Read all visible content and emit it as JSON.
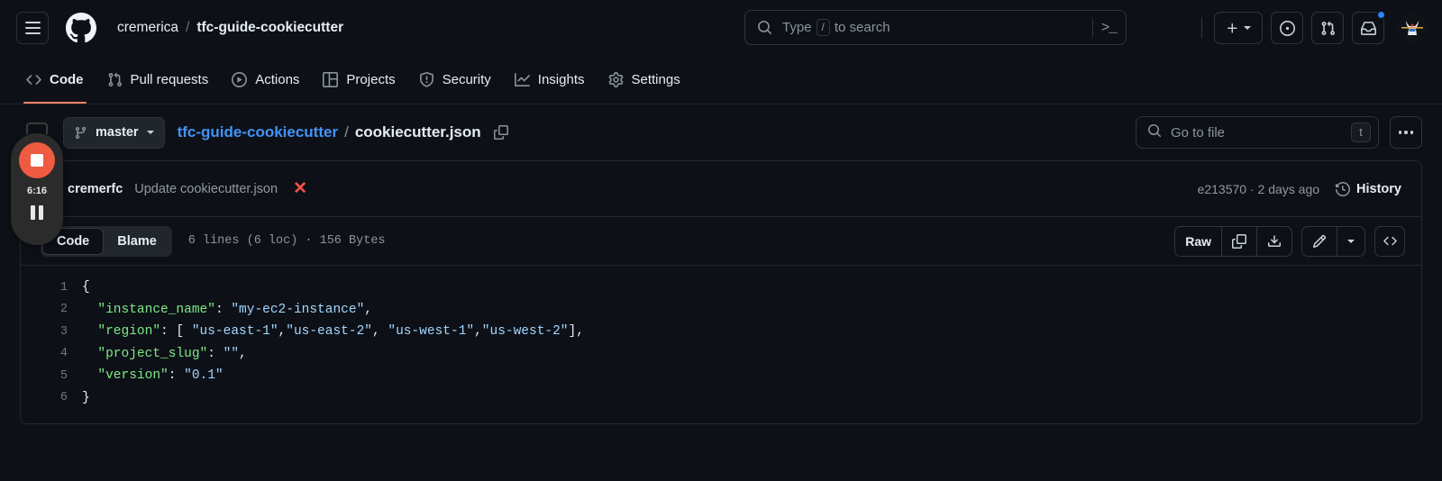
{
  "header": {
    "menu_icon": "hamburger-icon",
    "logo_icon": "github-logo-icon",
    "owner": "cremerica",
    "separator": "/",
    "repo": "tfc-guide-cookiecutter",
    "search": {
      "placeholder_prefix": "Type",
      "key_hint": "/",
      "placeholder_suffix": "to search",
      "search_icon": "search-icon",
      "terminal_icon": ">_"
    },
    "actions": {
      "create_new": "+",
      "issues_icon": "issue-opened-icon",
      "pull_requests_icon": "git-pull-request-icon",
      "notifications_icon": "inbox-icon",
      "avatar_icon": "user-avatar"
    }
  },
  "nav": {
    "tabs": [
      {
        "label": "Code",
        "icon": "code-icon",
        "active": true
      },
      {
        "label": "Pull requests",
        "icon": "git-pull-request-icon",
        "active": false
      },
      {
        "label": "Actions",
        "icon": "play-icon",
        "active": false
      },
      {
        "label": "Projects",
        "icon": "table-icon",
        "active": false
      },
      {
        "label": "Security",
        "icon": "shield-icon",
        "active": false
      },
      {
        "label": "Insights",
        "icon": "graph-icon",
        "active": false
      },
      {
        "label": "Settings",
        "icon": "gear-icon",
        "active": false
      }
    ]
  },
  "file_header": {
    "branch": "master",
    "branch_icon": "git-branch-icon",
    "path_repo": "tfc-guide-cookiecutter",
    "path_separator": "/",
    "path_file": "cookiecutter.json",
    "copy_path_icon": "copy-icon",
    "go_to_file_placeholder": "Go to file",
    "go_to_file_key": "t",
    "more_options": "…"
  },
  "commit": {
    "author": "cremerfc",
    "message": "Update cookiecutter.json",
    "status_icon": "✕",
    "status_color": "#f85149",
    "hash": "e213570",
    "meta": "e213570 · 2 days ago",
    "history_label": "History",
    "history_icon": "history-icon"
  },
  "file_toolbar": {
    "view_code": "Code",
    "view_blame": "Blame",
    "file_info": "6 lines (6 loc) · 156 Bytes",
    "raw_label": "Raw",
    "copy_icon": "copy-icon",
    "download_icon": "download-icon",
    "edit_icon": "pencil-icon",
    "edit_dropdown_icon": "chevron-down-icon",
    "symbols_icon": "code-symbols-icon"
  },
  "code": {
    "language": "json",
    "lines": [
      {
        "num": "1",
        "tokens": [
          {
            "t": "p",
            "v": "{"
          }
        ]
      },
      {
        "num": "2",
        "tokens": [
          {
            "t": "k",
            "v": "  \"instance_name\""
          },
          {
            "t": "p",
            "v": ": "
          },
          {
            "t": "s",
            "v": "\"my-ec2-instance\""
          },
          {
            "t": "p",
            "v": ","
          }
        ]
      },
      {
        "num": "3",
        "tokens": [
          {
            "t": "k",
            "v": "  \"region\""
          },
          {
            "t": "p",
            "v": ": [ "
          },
          {
            "t": "s",
            "v": "\"us-east-1\""
          },
          {
            "t": "p",
            "v": ","
          },
          {
            "t": "s",
            "v": "\"us-east-2\""
          },
          {
            "t": "p",
            "v": ", "
          },
          {
            "t": "s",
            "v": "\"us-west-1\""
          },
          {
            "t": "p",
            "v": ","
          },
          {
            "t": "s",
            "v": "\"us-west-2\""
          },
          {
            "t": "p",
            "v": "],"
          }
        ]
      },
      {
        "num": "4",
        "tokens": [
          {
            "t": "k",
            "v": "  \"project_slug\""
          },
          {
            "t": "p",
            "v": ": "
          },
          {
            "t": "s",
            "v": "\"\""
          },
          {
            "t": "p",
            "v": ","
          }
        ]
      },
      {
        "num": "5",
        "tokens": [
          {
            "t": "k",
            "v": "  \"version\""
          },
          {
            "t": "p",
            "v": ": "
          },
          {
            "t": "s",
            "v": "\"0.1\""
          }
        ]
      },
      {
        "num": "6",
        "tokens": [
          {
            "t": "p",
            "v": "}"
          }
        ]
      }
    ]
  },
  "recorder": {
    "timer": "6:16",
    "stop_icon": "stop-recording-icon",
    "pause_icon": "pause-icon"
  },
  "colors": {
    "page_bg": "#0d1117",
    "accent_tab": "#f78166",
    "link": "#4493f8",
    "json_key": "#7ee787",
    "json_string": "#a5d6ff",
    "error": "#f85149",
    "notification_dot": "#2f81f7",
    "record_red": "#ef5b41"
  }
}
